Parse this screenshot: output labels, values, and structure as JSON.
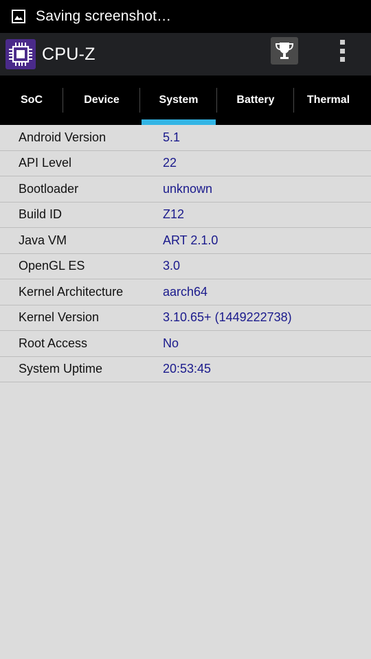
{
  "status_bar": {
    "text": "Saving screenshot…",
    "icon": "image-icon"
  },
  "app_bar": {
    "title": "CPU-Z",
    "logo_icon": "chip-icon",
    "trophy_icon": "trophy-icon",
    "menu_icon": "overflow-menu-icon"
  },
  "tabs": [
    {
      "label": "SoC",
      "active": false
    },
    {
      "label": "Device",
      "active": false
    },
    {
      "label": "System",
      "active": true
    },
    {
      "label": "Battery",
      "active": false
    },
    {
      "label": "Thermal",
      "active": false
    }
  ],
  "system_info": [
    {
      "label": "Android Version",
      "value": "5.1"
    },
    {
      "label": "API Level",
      "value": "22"
    },
    {
      "label": "Bootloader",
      "value": "unknown"
    },
    {
      "label": "Build ID",
      "value": "Z12"
    },
    {
      "label": "Java VM",
      "value": "ART 2.1.0"
    },
    {
      "label": "OpenGL ES",
      "value": "3.0"
    },
    {
      "label": "Kernel Architecture",
      "value": "aarch64"
    },
    {
      "label": "Kernel Version",
      "value": "3.10.65+ (1449222738)"
    },
    {
      "label": "Root Access",
      "value": "No"
    },
    {
      "label": "System Uptime",
      "value": "20:53:45"
    }
  ],
  "colors": {
    "accent": "#33b5e5",
    "value_text": "#1a1a8c",
    "background": "#dcdcdc"
  }
}
